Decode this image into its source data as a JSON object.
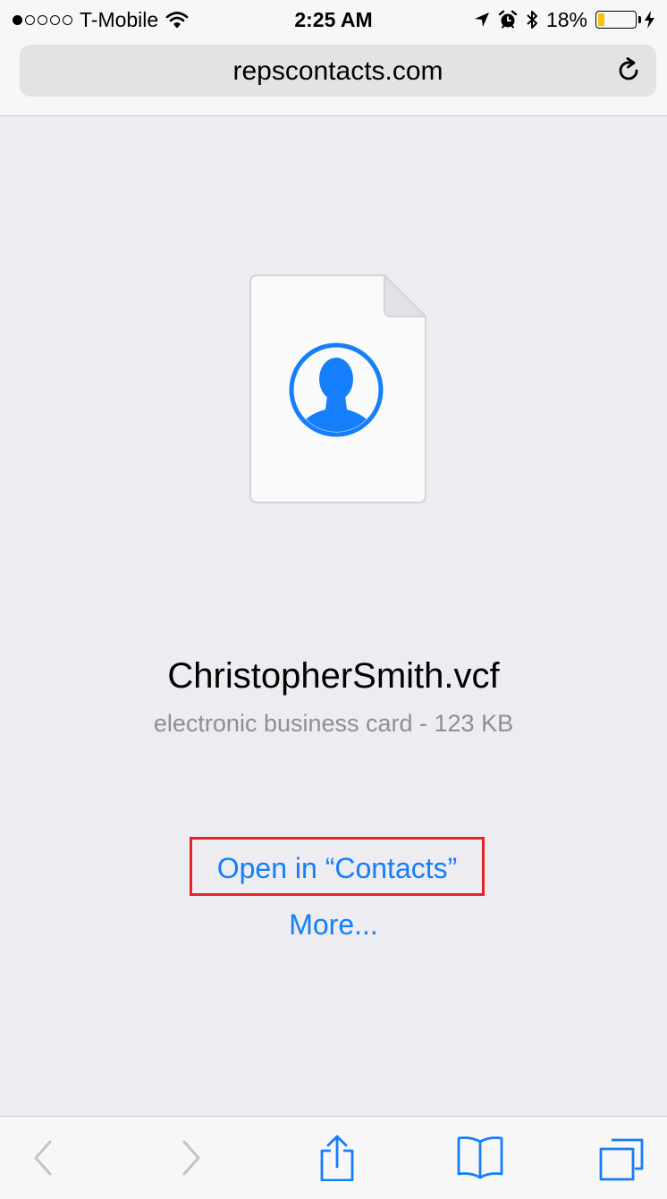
{
  "status_bar": {
    "carrier": "T-Mobile",
    "time": "2:25 AM",
    "battery_percent": "18%",
    "battery_level": 0.18,
    "signal_bars_filled": 1,
    "signal_bars_total": 5,
    "icons": [
      "wifi-icon",
      "location-arrow-icon",
      "alarm-clock-icon",
      "bluetooth-icon",
      "battery-icon",
      "charging-bolt-icon"
    ]
  },
  "url_bar": {
    "url": "repscontacts.com",
    "reload_icon": "reload-icon"
  },
  "file": {
    "icon": "contact-card-file-icon",
    "name": "ChristopherSmith.vcf",
    "meta": "electronic business card - 123 KB"
  },
  "actions": {
    "open_label": "Open in “Contacts”",
    "more_label": "More..."
  },
  "toolbar": {
    "items": [
      "back-icon",
      "forward-icon",
      "share-icon",
      "bookmarks-icon",
      "tabs-icon"
    ]
  },
  "colors": {
    "accent": "#147efb",
    "highlight": "#e3242b",
    "content_bg": "#ececf1",
    "secondary_text": "#8e8e93",
    "battery_fill": "#f5c400"
  }
}
